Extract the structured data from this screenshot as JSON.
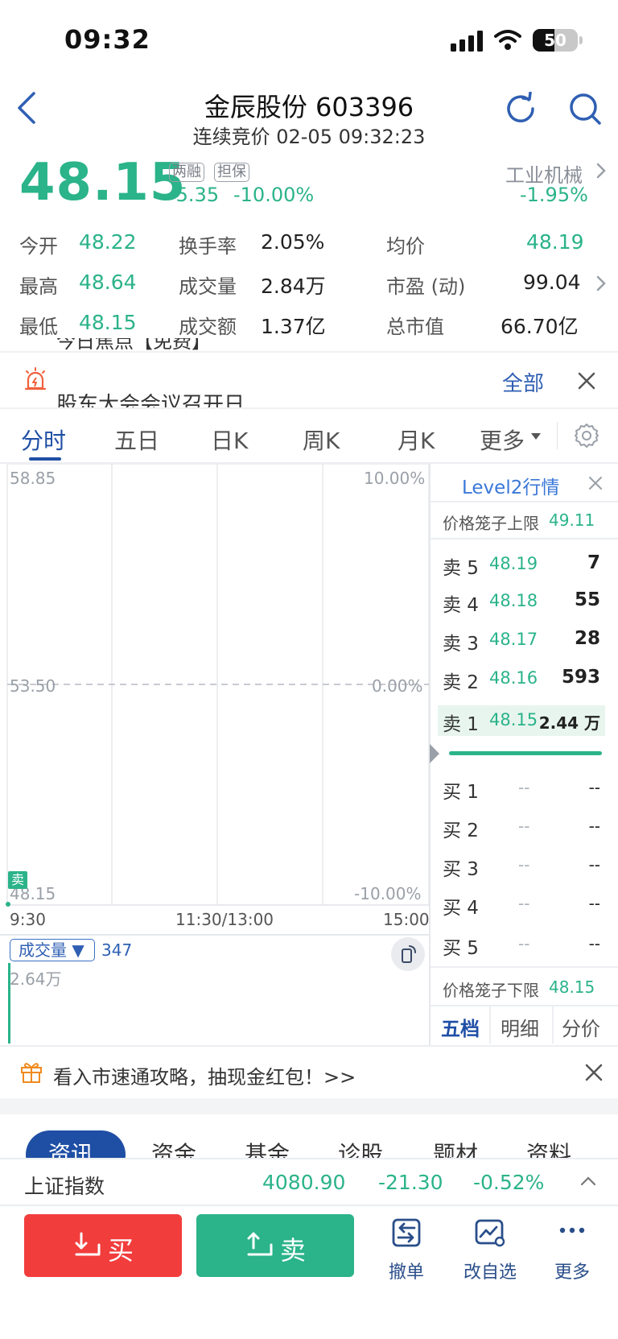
{
  "status_bar": {
    "time": "09:32",
    "battery": "50"
  },
  "header": {
    "title": "金辰股份 603396",
    "subtitle": "连续竞价 02-05 09:32:23"
  },
  "quote": {
    "price": "48.15",
    "tags": [
      "两融",
      "担保"
    ],
    "change": "-5.35",
    "change_pct": "-10.00%",
    "industry": "工业机械",
    "industry_pct": "-1.95%",
    "colors": {
      "down": "#2bb38a",
      "up": "#f23d3d",
      "accent": "#1f4fa5"
    }
  },
  "stats": {
    "open_label": "今开",
    "open": "48.22",
    "turnover_label": "换手率",
    "turnover": "2.05%",
    "avg_label": "均价",
    "avg": "48.19",
    "high_label": "最高",
    "high": "48.64",
    "volume_label": "成交量",
    "volume": "2.84万",
    "pe_label": "市盈 (动)",
    "pe": "99.04",
    "low_label": "最低",
    "low": "48.15",
    "amount_label": "成交额",
    "amount": "1.37亿",
    "mcap_label": "总市值",
    "mcap": "66.70亿"
  },
  "notice": {
    "ghost_top": "今日焦点【免费】",
    "ghost_bottom": "股东大会会议召开日",
    "all_label": "全部"
  },
  "chart_tabs": [
    "分时",
    "五日",
    "日K",
    "周K",
    "月K",
    "更多"
  ],
  "chart": {
    "y_top": "58.85",
    "y_mid": "53.50",
    "y_bottom": "48.15",
    "pct_top": "10.00%",
    "pct_mid": "0.00%",
    "pct_bottom": "-10.00%",
    "x_start": "9:30",
    "x_mid": "11:30/13:00",
    "x_end": "15:00",
    "sell_marker": "卖",
    "volume_label": "成交量 ▼",
    "volume_value": "347",
    "volume_max": "2.64万"
  },
  "level2": {
    "title": "Level2行情",
    "cage_upper_label": "价格笼子上限",
    "cage_upper": "49.11",
    "asks": [
      {
        "label": "卖 5",
        "price": "48.19",
        "vol": "7"
      },
      {
        "label": "卖 4",
        "price": "48.18",
        "vol": "55"
      },
      {
        "label": "卖 3",
        "price": "48.17",
        "vol": "28"
      },
      {
        "label": "卖 2",
        "price": "48.16",
        "vol": "593"
      },
      {
        "label": "卖 1",
        "price": "48.15",
        "vol": "2.44 万"
      }
    ],
    "bids": [
      {
        "label": "买 1",
        "price": "--",
        "vol": "--"
      },
      {
        "label": "买 2",
        "price": "--",
        "vol": "--"
      },
      {
        "label": "买 3",
        "price": "--",
        "vol": "--"
      },
      {
        "label": "买 4",
        "price": "--",
        "vol": "--"
      },
      {
        "label": "买 5",
        "price": "--",
        "vol": "--"
      }
    ],
    "cage_lower_label": "价格笼子下限",
    "cage_lower": "48.15",
    "tabs": [
      "五档",
      "明细",
      "分价"
    ]
  },
  "promo": {
    "text": "看入市速通攻略，抽现金红包！>>"
  },
  "news_tabs": [
    "资讯",
    "资金",
    "基金",
    "诊股",
    "题材",
    "资料"
  ],
  "index_bar": {
    "name": "上证指数",
    "value": "4080.90",
    "change": "-21.30",
    "pct": "-0.52%"
  },
  "actions": {
    "buy": "买",
    "sell": "卖",
    "cancel": "撤单",
    "edit_watch": "改自选",
    "more": "更多"
  }
}
